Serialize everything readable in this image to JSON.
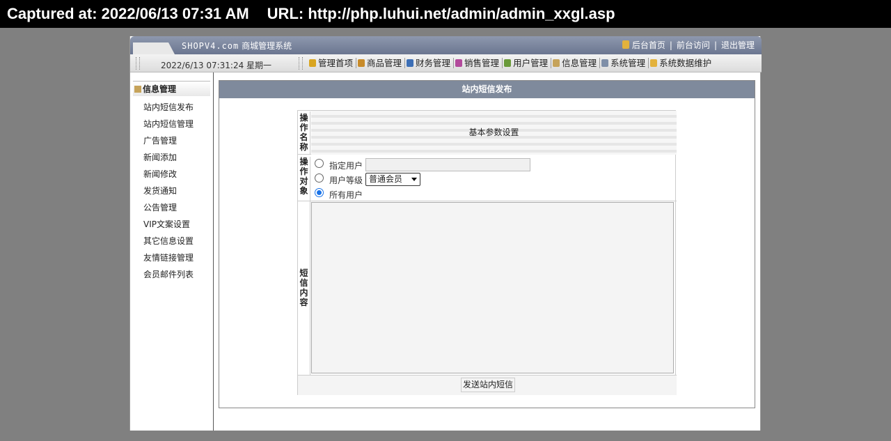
{
  "capture": {
    "captured_at_label": "Captured at: 2022/06/13 07:31 AM",
    "url_label": "URL: http://php.luhui.net/admin/admin_xxgl.asp"
  },
  "header": {
    "logo_text": "SHOPV4.com",
    "system_name": "商城管理系统",
    "links": [
      "后台首页",
      "前台访问",
      "退出管理"
    ],
    "clock": "2022/6/13 07:31:24 星期一"
  },
  "menu": {
    "items": [
      {
        "label": "管理首项",
        "icon": "home-icon",
        "color": "#d9a521"
      },
      {
        "label": "商品管理",
        "icon": "goods-icon",
        "color": "#c88b2a"
      },
      {
        "label": "财务管理",
        "icon": "finance-icon",
        "color": "#3d6fb6"
      },
      {
        "label": "销售管理",
        "icon": "chart-icon",
        "color": "#b34a9c"
      },
      {
        "label": "用户管理",
        "icon": "user-icon",
        "color": "#6a9a3a"
      },
      {
        "label": "信息管理",
        "icon": "info-icon",
        "color": "#c6a35a"
      },
      {
        "label": "系统管理",
        "icon": "system-icon",
        "color": "#7f8fa8"
      },
      {
        "label": "系统数据维护",
        "icon": "lock-icon",
        "color": "#e3b23c"
      }
    ]
  },
  "sidebar": {
    "title": "信息管理",
    "items": [
      "站内短信发布",
      "站内短信管理",
      "广告管理",
      "新闻添加",
      "新闻修改",
      "发货通知",
      "公告管理",
      "VIP文案设置",
      "其它信息设置",
      "友情链接管理",
      "会员邮件列表"
    ]
  },
  "main": {
    "title": "站内短信发布",
    "form": {
      "row1_label": "操作名称",
      "row1_value": "基本参数设置",
      "row2_label": "操作对象",
      "option_user": "指定用户",
      "option_level": "用户等级",
      "level_selected": "普通会员",
      "option_all": "所有用户",
      "selected_option": "所有用户",
      "row3_label": "短信内容",
      "message_value": "",
      "submit_label": "发送站内短信"
    }
  }
}
